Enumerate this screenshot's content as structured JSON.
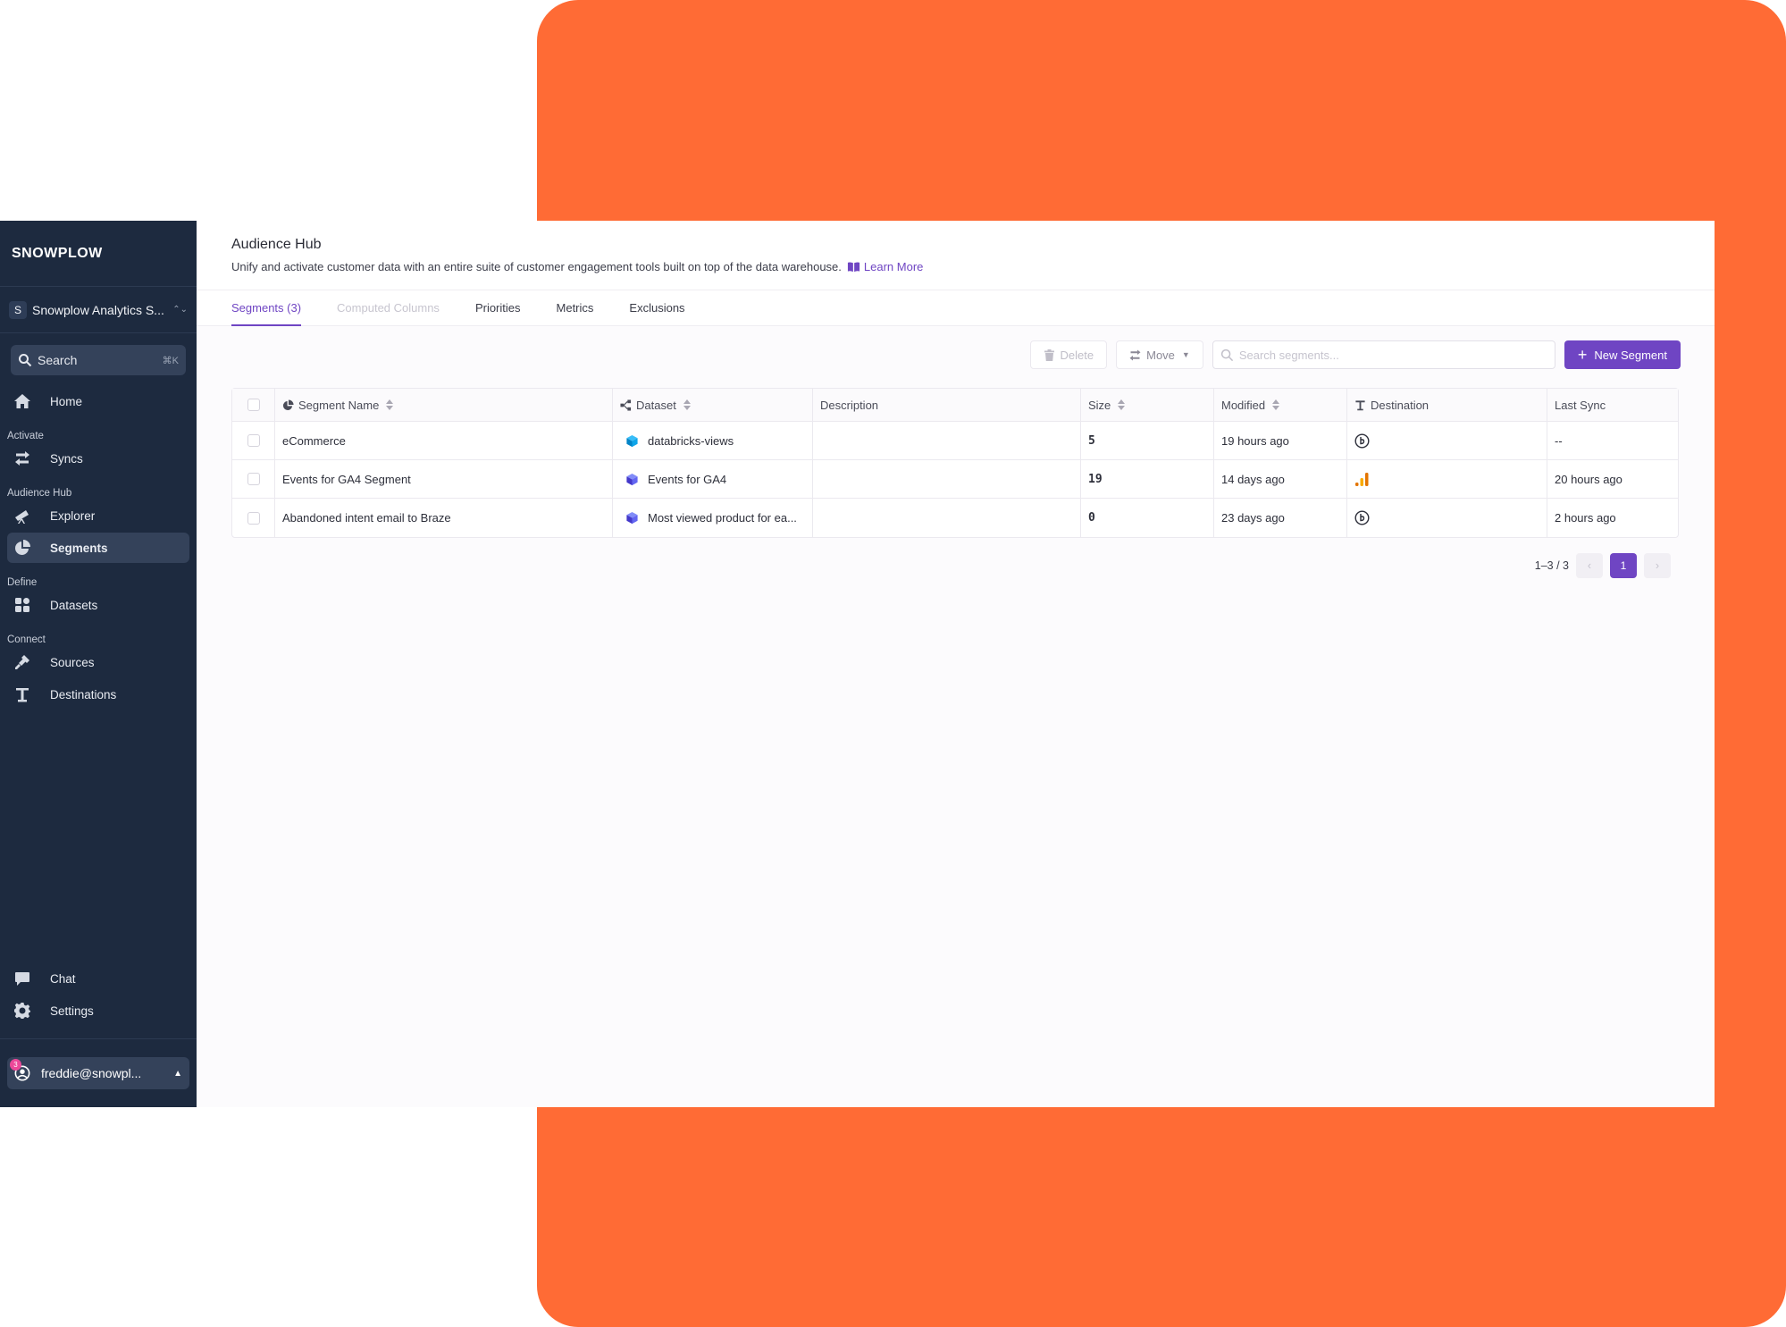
{
  "brand": {
    "logo_text": "SNOWPLOW",
    "accent": "#6f45c3",
    "sidebar_bg": "#1d2a3f",
    "backdrop": "#ff6b35"
  },
  "org": {
    "badge": "S",
    "name": "Snowplow Analytics S..."
  },
  "search": {
    "label": "Search",
    "shortcut": "⌘K"
  },
  "nav": {
    "home": "Home",
    "section_activate": "Activate",
    "syncs": "Syncs",
    "section_audience": "Audience Hub",
    "explorer": "Explorer",
    "segments": "Segments",
    "section_define": "Define",
    "datasets": "Datasets",
    "section_connect": "Connect",
    "sources": "Sources",
    "destinations": "Destinations",
    "chat": "Chat",
    "settings": "Settings"
  },
  "user": {
    "email": "freddie@snowpl...",
    "badge_count": "3"
  },
  "header": {
    "title": "Audience Hub",
    "subtitle": "Unify and activate customer data with an entire suite of customer engagement tools built on top of the data warehouse.",
    "learn_more": "Learn More"
  },
  "tabs": [
    "Segments (3)",
    "Computed Columns",
    "Priorities",
    "Metrics",
    "Exclusions"
  ],
  "toolbar": {
    "delete": "Delete",
    "move": "Move",
    "search_placeholder": "Search segments...",
    "new_segment": "New Segment"
  },
  "table": {
    "columns": [
      "Segment Name",
      "Dataset",
      "Description",
      "Size",
      "Modified",
      "Destination",
      "Last Sync"
    ],
    "rows": [
      {
        "name": "eCommerce",
        "dataset": "databricks-views",
        "description": "",
        "size": "5",
        "modified": "19 hours ago",
        "destination_icon": "clock-destination-icon",
        "last_sync": "--"
      },
      {
        "name": "Events for GA4 Segment",
        "dataset": "Events for GA4",
        "description": "",
        "size": "19",
        "modified": "14 days ago",
        "destination_icon": "google-analytics-icon",
        "last_sync": "20 hours ago"
      },
      {
        "name": "Abandoned intent email to Braze",
        "dataset": "Most viewed product for ea...",
        "description": "",
        "size": "0",
        "modified": "23 days ago",
        "destination_icon": "clock-destination-icon",
        "last_sync": "2 hours ago"
      }
    ]
  },
  "pager": {
    "range": "1–3 / 3",
    "prev": "‹",
    "page": "1",
    "next": "›"
  }
}
